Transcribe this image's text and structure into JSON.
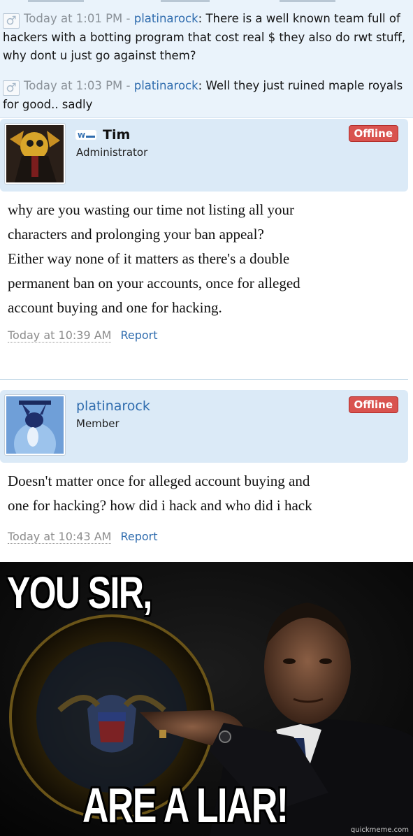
{
  "comments": [
    {
      "time": "Today at 1:01 PM",
      "sep": " - ",
      "user": "platinarock",
      "colon": ":",
      "text": " There is a well known team full of hackers with a botting program that cost real $ they also do rwt stuff, why dont u just go against them?"
    },
    {
      "time": "Today at 1:03 PM",
      "sep": " - ",
      "user": "platinarock",
      "colon": ":",
      "text": " Well they just ruined maple royals for good.. sadly"
    }
  ],
  "gender_icon": "male-symbol-icon",
  "messages": [
    {
      "name": "Tim",
      "role": "Administrator",
      "status": "Offline",
      "body_lines": [
        "why are you wasting our time not listing all your",
        "characters and prolonging your ban appeal?",
        "Either way none of it matters as there's a double",
        "permanent ban on your accounts, once for alleged",
        "account buying and one for hacking."
      ],
      "date": "Today at 10:39 AM",
      "report": "Report"
    },
    {
      "name": "platinarock",
      "role": "Member",
      "status": "Offline",
      "body_lines": [
        "Doesn't matter once for alleged account buying and",
        "one for hacking? how did i hack and who did i hack"
      ],
      "date": "Today at 10:43 AM",
      "report": "Report"
    }
  ],
  "meme": {
    "top_text": "YOU SIR,",
    "bottom_text": "ARE A LIAR!",
    "watermark": "quickmeme.com"
  },
  "colors": {
    "link": "#2f6cae",
    "offline_badge": "#d9534f",
    "userbar": "#dbeaf7"
  }
}
